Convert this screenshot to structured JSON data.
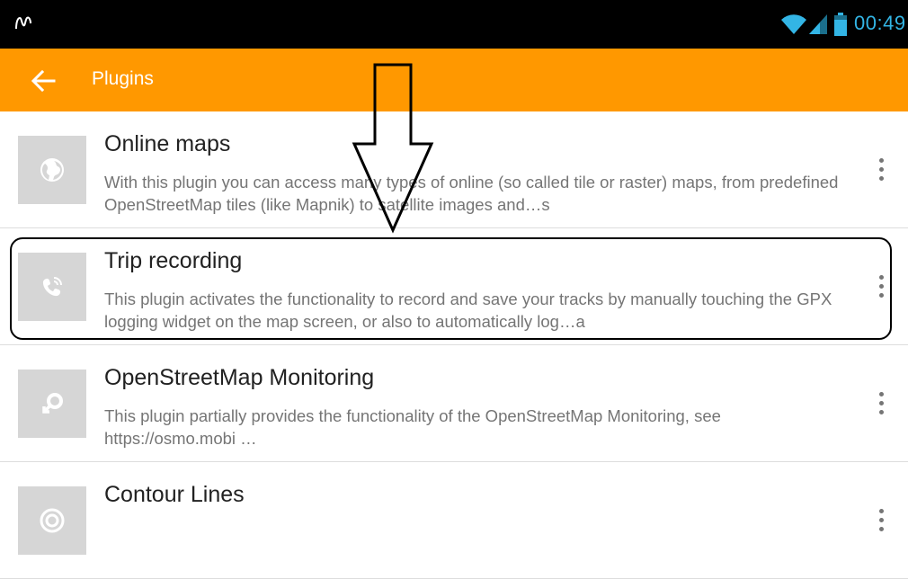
{
  "status_bar": {
    "time": "00:49",
    "left_icon": "steps-icon",
    "icons": [
      "wifi-icon",
      "signal-icon",
      "battery-icon"
    ],
    "accent_color": "#33b5e5"
  },
  "app_bar": {
    "title": "Plugins",
    "back_icon": "back-arrow-icon",
    "color": "#ff9800"
  },
  "plugins": [
    {
      "name": "Online maps",
      "description": "With this plugin you can access many types of online (so called tile or raster) maps, from predefined OpenStreetMap tiles (like Mapnik) to satellite images and…s",
      "icon": "globe-icon"
    },
    {
      "name": "Trip recording",
      "description": "This plugin activates the functionality to record and save your tracks by manually touching the GPX logging widget on the map screen, or also to automatically log…a",
      "icon": "trip-recording-icon"
    },
    {
      "name": "OpenStreetMap Monitoring",
      "description": "This plugin partially provides the functionality of the OpenStreetMap Monitoring, see https://osmo.mobi …",
      "icon": "monitoring-icon"
    },
    {
      "name": "Contour Lines",
      "description": "",
      "icon": "contour-lines-icon"
    }
  ],
  "annotations": {
    "highlighted_item": "Trip recording",
    "arrow": "down-arrow-annotation"
  }
}
